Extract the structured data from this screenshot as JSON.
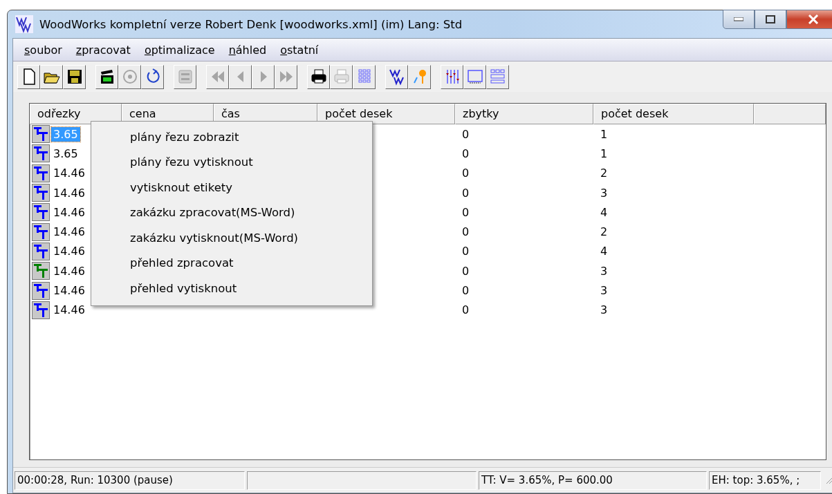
{
  "window": {
    "title": "WoodWorks kompletní verze Robert Denk [woodworks.xml] (im) Lang: Std"
  },
  "menu_bar": [
    "soubor",
    "zpracovat",
    "optimalizace",
    "náhled",
    "ostatní"
  ],
  "toolbar": [
    {
      "kind": "new",
      "disabled": false
    },
    {
      "kind": "open",
      "disabled": false
    },
    {
      "kind": "save",
      "disabled": false
    },
    {
      "kind": "gap"
    },
    {
      "kind": "go",
      "disabled": false
    },
    {
      "kind": "target",
      "disabled": true
    },
    {
      "kind": "refresh",
      "disabled": false
    },
    {
      "kind": "gap"
    },
    {
      "kind": "topten",
      "disabled": true
    },
    {
      "kind": "gap"
    },
    {
      "kind": "first",
      "disabled": true
    },
    {
      "kind": "prev",
      "disabled": true
    },
    {
      "kind": "next",
      "disabled": true
    },
    {
      "kind": "last",
      "disabled": true
    },
    {
      "kind": "gap"
    },
    {
      "kind": "print",
      "disabled": false
    },
    {
      "kind": "print",
      "disabled": true
    },
    {
      "kind": "grid",
      "disabled": false
    },
    {
      "kind": "gap"
    },
    {
      "kind": "logo",
      "disabled": false
    },
    {
      "kind": "key",
      "disabled": false
    },
    {
      "kind": "gap"
    },
    {
      "kind": "sliders",
      "disabled": false
    },
    {
      "kind": "frame",
      "disabled": false
    },
    {
      "kind": "layout",
      "disabled": false
    }
  ],
  "table": {
    "columns": [
      "odřezky",
      "cena",
      "čas",
      "počet desek",
      "zbytky",
      "počet desek"
    ],
    "rows": [
      {
        "color": "#0000ff",
        "selected": true,
        "cells": [
          "3.65",
          "0",
          "1"
        ]
      },
      {
        "color": "#0000ff",
        "selected": false,
        "cells": [
          "3.65",
          "0",
          "1"
        ]
      },
      {
        "color": "#0000ff",
        "selected": false,
        "cells": [
          "14.46",
          "0",
          "2"
        ]
      },
      {
        "color": "#0000ff",
        "selected": false,
        "cells": [
          "14.46",
          "0",
          "3"
        ]
      },
      {
        "color": "#0000ff",
        "selected": false,
        "cells": [
          "14.46",
          "0",
          "4"
        ]
      },
      {
        "color": "#0000ff",
        "selected": false,
        "cells": [
          "14.46",
          "0",
          "2"
        ]
      },
      {
        "color": "#0000ff",
        "selected": false,
        "cells": [
          "14.46",
          "0",
          "4"
        ]
      },
      {
        "color": "#008000",
        "selected": false,
        "cells": [
          "14.46",
          "0",
          "3"
        ]
      },
      {
        "color": "#0000ff",
        "selected": false,
        "cells": [
          "14.46",
          "0",
          "3"
        ]
      },
      {
        "color": "#0000ff",
        "selected": false,
        "cells": [
          "14.46",
          "0",
          "3"
        ]
      }
    ]
  },
  "context_menu": [
    "plány řezu zobrazit",
    "plány řezu vytisknout",
    "vytisknout etikety",
    "zakázku zpracovat(MS-Word)",
    "zakázku vytisknout(MS-Word)",
    "přehled zpracovat",
    "přehled vytisknout"
  ],
  "status_bar": [
    "00:00:28, Run: 10300 (pause)",
    "TT: V= 3.65%, P= 600.00",
    "EH: top: 3.65%, ;"
  ]
}
